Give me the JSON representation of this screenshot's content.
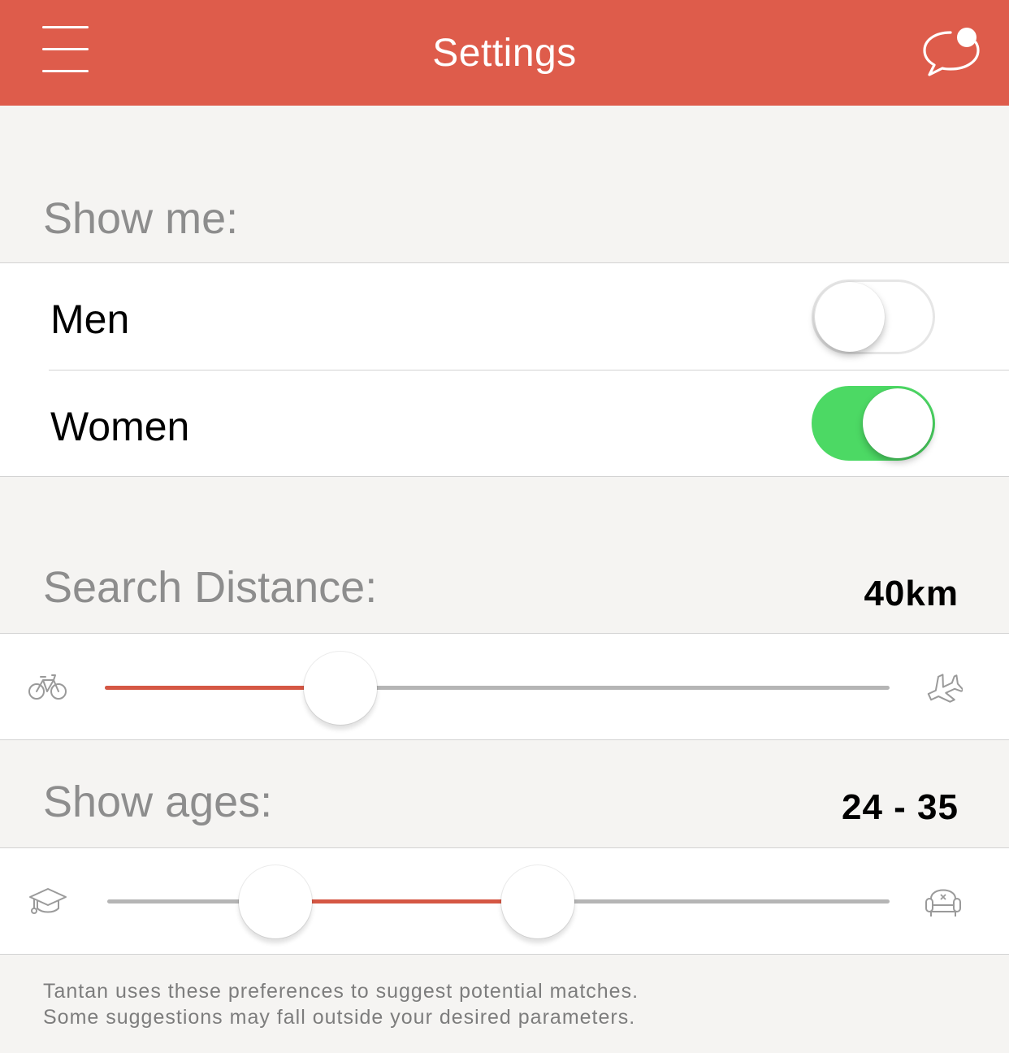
{
  "header": {
    "title": "Settings",
    "bg_color": "#de5c4b",
    "menu_icon": "menu-icon",
    "messages_icon": "chat-bubble-icon",
    "has_notification_dot": true
  },
  "show_me": {
    "label": "Show me:",
    "options": [
      {
        "label": "Men",
        "enabled": false
      },
      {
        "label": "Women",
        "enabled": true
      }
    ],
    "toggle_on_color": "#4cd964"
  },
  "search_distance": {
    "label": "Search Distance:",
    "value_text": "40km",
    "fill_fraction": 0.3,
    "min_icon": "bicycle-icon",
    "max_icon": "airplane-icon",
    "accent_color": "#d55744"
  },
  "show_ages": {
    "label": "Show ages:",
    "value_text": "24 - 35",
    "low_fraction": 0.215,
    "high_fraction": 0.55,
    "min_icon": "graduation-cap-icon",
    "max_icon": "armchair-icon",
    "accent_color": "#d55744"
  },
  "footer": {
    "line1": "Tantan uses these preferences to suggest potential matches.",
    "line2": "Some suggestions may fall outside your desired parameters."
  }
}
